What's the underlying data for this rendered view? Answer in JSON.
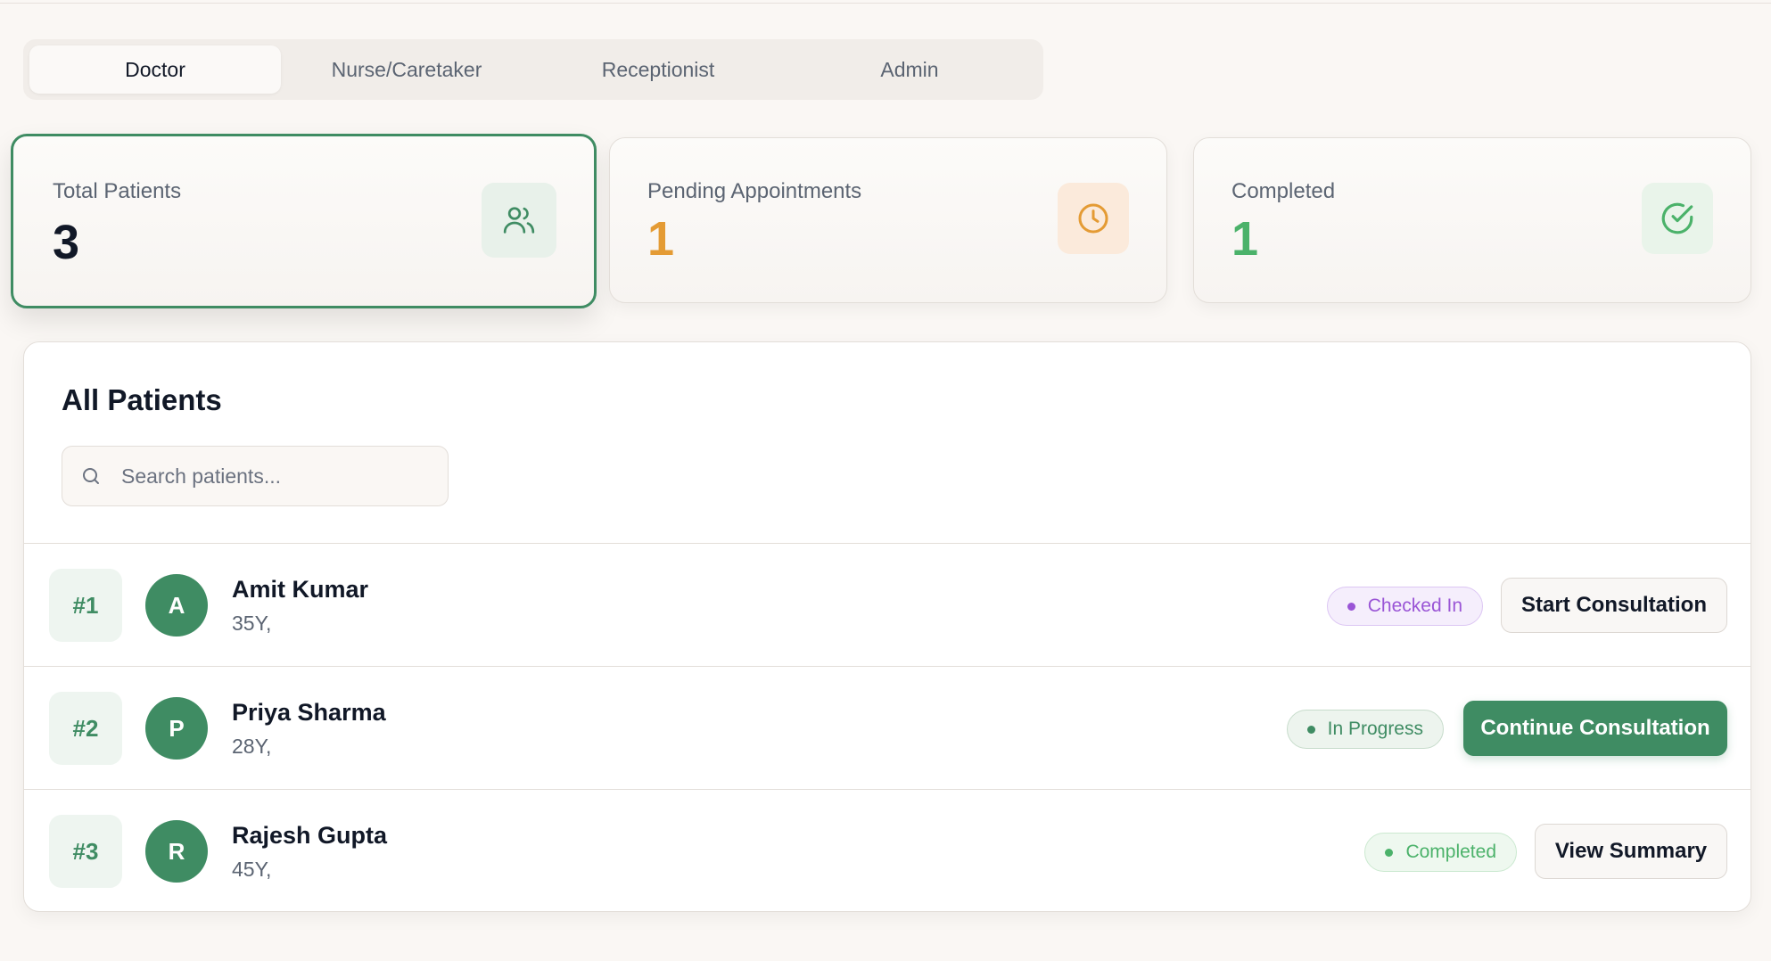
{
  "role_tabs": [
    {
      "label": "Doctor",
      "active": true
    },
    {
      "label": "Nurse/Caretaker",
      "active": false
    },
    {
      "label": "Receptionist",
      "active": false
    },
    {
      "label": "Admin",
      "active": false
    }
  ],
  "stats": [
    {
      "label": "Total Patients",
      "value": "3",
      "icon": "users-icon",
      "accent": "#3f8c63"
    },
    {
      "label": "Pending Appointments",
      "value": "1",
      "icon": "clock-icon",
      "accent": "#e49b34"
    },
    {
      "label": "Completed",
      "value": "1",
      "icon": "check-circle-icon",
      "accent": "#4bb26a"
    }
  ],
  "patients_panel": {
    "title": "All Patients",
    "search_placeholder": "Search patients..."
  },
  "patients": [
    {
      "rank": "#1",
      "initial": "A",
      "name": "Amit Kumar",
      "meta": "35Y,",
      "status": "Checked In",
      "action": "Start Consultation"
    },
    {
      "rank": "#2",
      "initial": "P",
      "name": "Priya Sharma",
      "meta": "28Y,",
      "status": "In Progress",
      "action": "Continue Consultation"
    },
    {
      "rank": "#3",
      "initial": "R",
      "name": "Rajesh Gupta",
      "meta": "45Y,",
      "status": "Completed",
      "action": "View Summary"
    }
  ],
  "colors": {
    "primary": "#3f8c63",
    "pending": "#e49b34",
    "completed": "#4bb26a",
    "checked_in": "#9a55d6"
  }
}
